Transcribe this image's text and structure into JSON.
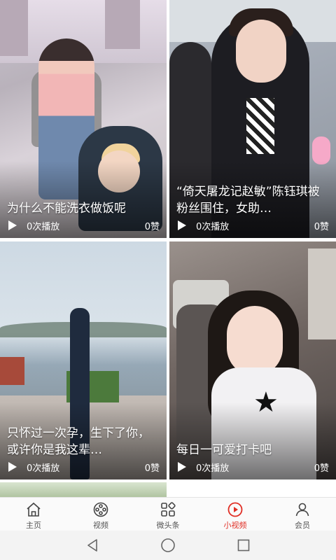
{
  "feed": {
    "cards": [
      {
        "title": "为什么不能洗衣做饭呢",
        "plays": "0次播放",
        "likes": "0赞"
      },
      {
        "title": "“倚天屠龙记赵敏”陈钰琪被粉丝围住，女助…",
        "plays": "0次播放",
        "likes": "0赞"
      },
      {
        "title": "只怀过一次孕，生下了你，或许你是我这辈…",
        "plays": "0次播放",
        "likes": "0赞"
      },
      {
        "title": "每日一可爱打卡吧",
        "plays": "0次播放",
        "likes": "0赞"
      }
    ]
  },
  "tabbar": {
    "accent_color": "#e02e24",
    "items": [
      {
        "label": "主页",
        "icon": "home-icon"
      },
      {
        "label": "视频",
        "icon": "film-reel-icon"
      },
      {
        "label": "微头条",
        "icon": "grid-icon"
      },
      {
        "label": "小视频",
        "icon": "play-circle-icon",
        "active": true
      },
      {
        "label": "会员",
        "icon": "person-icon"
      }
    ]
  },
  "system_nav": {
    "buttons": [
      {
        "icon": "back-triangle-icon"
      },
      {
        "icon": "home-circle-icon"
      },
      {
        "icon": "recents-square-icon"
      }
    ]
  }
}
